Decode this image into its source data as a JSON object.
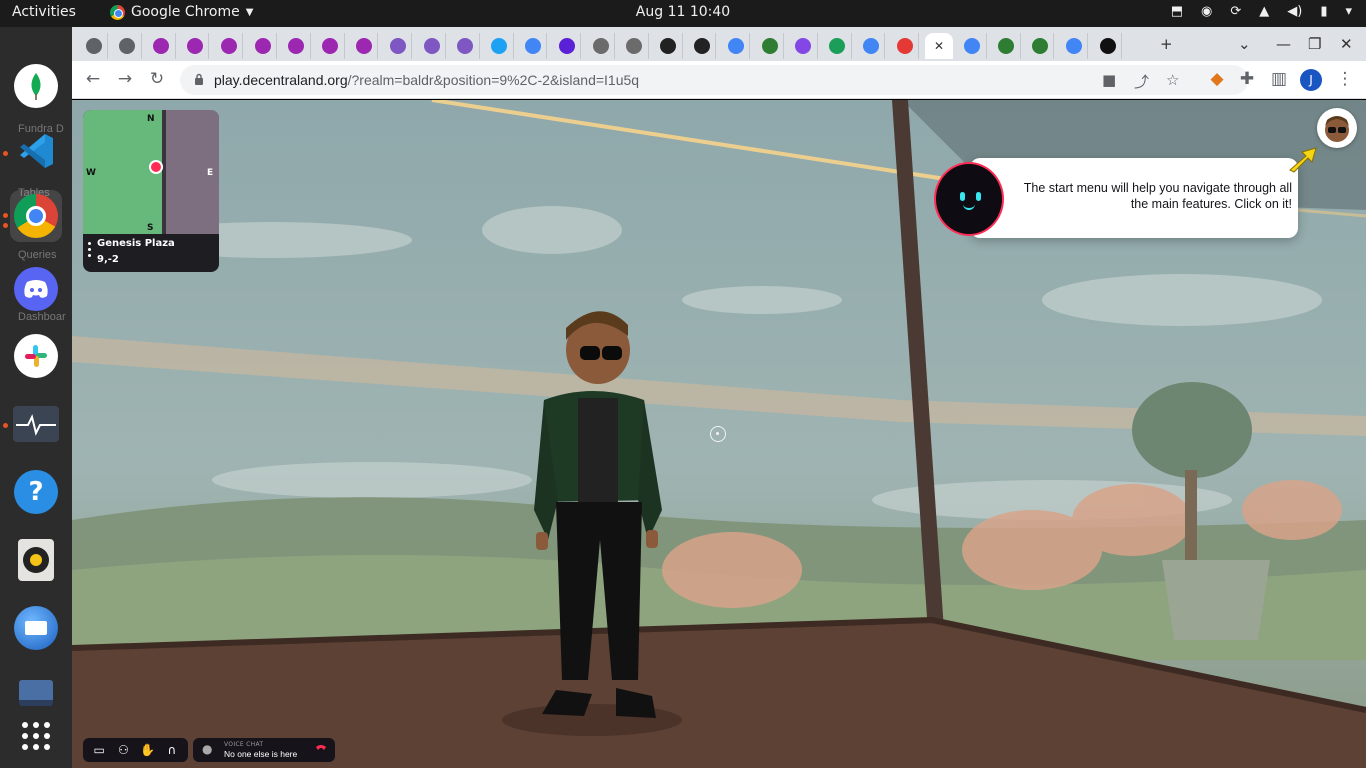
{
  "system_bar": {
    "activities": "Activities",
    "app_name": "Google Chrome",
    "clock": "Aug 11  10:40"
  },
  "dock": {
    "ghost_labels": [
      "Fundra D",
      "Tables",
      "Queries",
      "Dashboar"
    ],
    "apps": [
      "mongodb-compass",
      "vscode",
      "chrome",
      "discord",
      "slack",
      "system-monitor",
      "help",
      "rhythmbox",
      "thunderbird",
      "disks",
      "show-applications"
    ]
  },
  "browser": {
    "url_host": "play.decentraland.org",
    "url_path": "/?realm=baldr&position=9%2C-2&island=I1u5q",
    "profile_initial": "J",
    "tab_count": 31
  },
  "minimap": {
    "compass": {
      "n": "N",
      "s": "S",
      "w": "W",
      "e": "E"
    },
    "place_name": "Genesis Plaza",
    "coords": "9,-2"
  },
  "tutorial": {
    "message": "The start menu will help you navigate through all the main features. Click on it!"
  },
  "voice_chat": {
    "label": "VOICE CHAT",
    "status": "No one else is here"
  },
  "colors": {
    "accent_red": "#ff2d55",
    "map_green": "#66b97a",
    "ubuntu_orange": "#e95420"
  }
}
